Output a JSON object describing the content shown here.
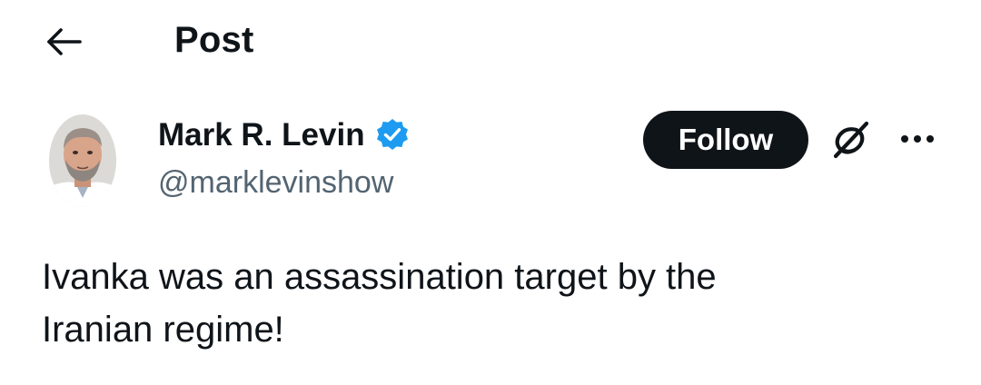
{
  "header": {
    "title": "Post",
    "back_icon": "arrow-left-icon"
  },
  "author": {
    "display_name": "Mark R. Levin",
    "handle": "@marklevinshow",
    "verified_icon": "verified-badge-icon",
    "verified_color": "#1d9bf0"
  },
  "actions": {
    "follow_label": "Follow",
    "grok_icon": "grok-icon",
    "more_icon": "more-options-icon"
  },
  "post": {
    "line1": "Ivanka was an assassination target by the",
    "line2": "Iranian regime!"
  },
  "colors": {
    "text_primary": "#0f1419",
    "text_secondary": "#536471",
    "button_bg": "#0f1419",
    "button_text": "#ffffff",
    "background": "#ffffff"
  }
}
